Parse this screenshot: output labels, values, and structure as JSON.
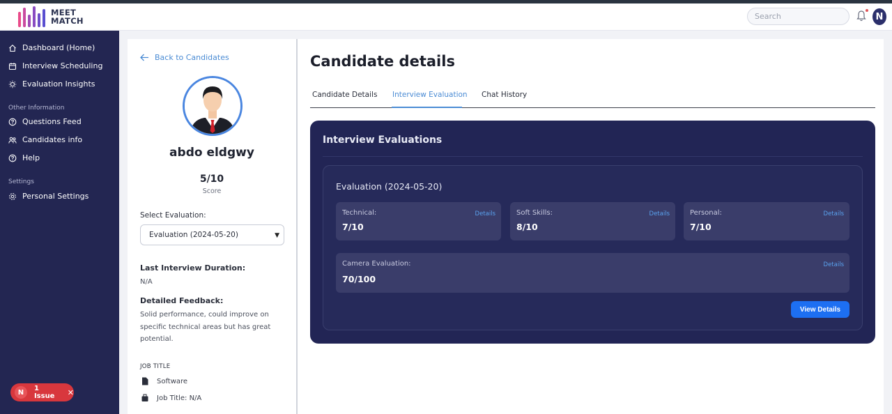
{
  "app": {
    "logo_line1": "MEET",
    "logo_line2": "MATCH",
    "search_placeholder": "Search",
    "user_initial": "N"
  },
  "colors": {
    "sidebar_bg": "#232652",
    "card_bg": "#222555",
    "accent_blue": "#4a8bd4",
    "button_blue": "#1d6ff2",
    "issue_red": "#d8373d"
  },
  "sidebar": {
    "items": [
      {
        "label": "Dashboard (Home)",
        "icon": "home-icon"
      },
      {
        "label": "Interview Scheduling",
        "icon": "calendar-icon"
      },
      {
        "label": "Evaluation Insights",
        "icon": "lightbulb-icon"
      }
    ],
    "section_other": "Other Information",
    "other_items": [
      {
        "label": "Questions Feed",
        "icon": "question-icon"
      },
      {
        "label": "Candidates info",
        "icon": "users-icon"
      },
      {
        "label": "Help",
        "icon": "help-icon"
      }
    ],
    "section_settings": "Settings",
    "settings_items": [
      {
        "label": "Personal Settings",
        "icon": "gear-icon"
      }
    ]
  },
  "issue_badge": {
    "initial": "N",
    "label": "1 Issue",
    "close": "✕"
  },
  "candidate": {
    "back_label": "Back to Candidates",
    "name": "abdo eldgwy",
    "score": "5/10",
    "score_label": "Score",
    "select_label": "Select Evaluation:",
    "selected_evaluation": "Evaluation (2024-05-20)",
    "duration_label": "Last Interview Duration:",
    "duration_value": "N/A",
    "feedback_label": "Detailed Feedback:",
    "feedback_text": "Solid performance, could improve on specific technical areas but has great potential.",
    "job_title_heading": "JOB TITLE",
    "job_field": "Software",
    "job_title_row": "Job Title: N/A"
  },
  "main": {
    "page_title": "Candidate details",
    "tabs": [
      {
        "label": "Candidate Details",
        "active": false
      },
      {
        "label": "Interview Evaluation",
        "active": true
      },
      {
        "label": "Chat History",
        "active": false
      }
    ],
    "evaluations_title": "Interview Evaluations",
    "evaluation": {
      "title": "Evaluation (2024-05-20)",
      "metrics": [
        {
          "label": "Technical:",
          "value": "7/10",
          "link": "Details"
        },
        {
          "label": "Soft Skills:",
          "value": "8/10",
          "link": "Details"
        },
        {
          "label": "Personal:",
          "value": "7/10",
          "link": "Details"
        }
      ],
      "camera": {
        "label": "Camera Evaluation:",
        "value": "70/100",
        "link": "Details"
      },
      "view_details": "View Details"
    }
  }
}
